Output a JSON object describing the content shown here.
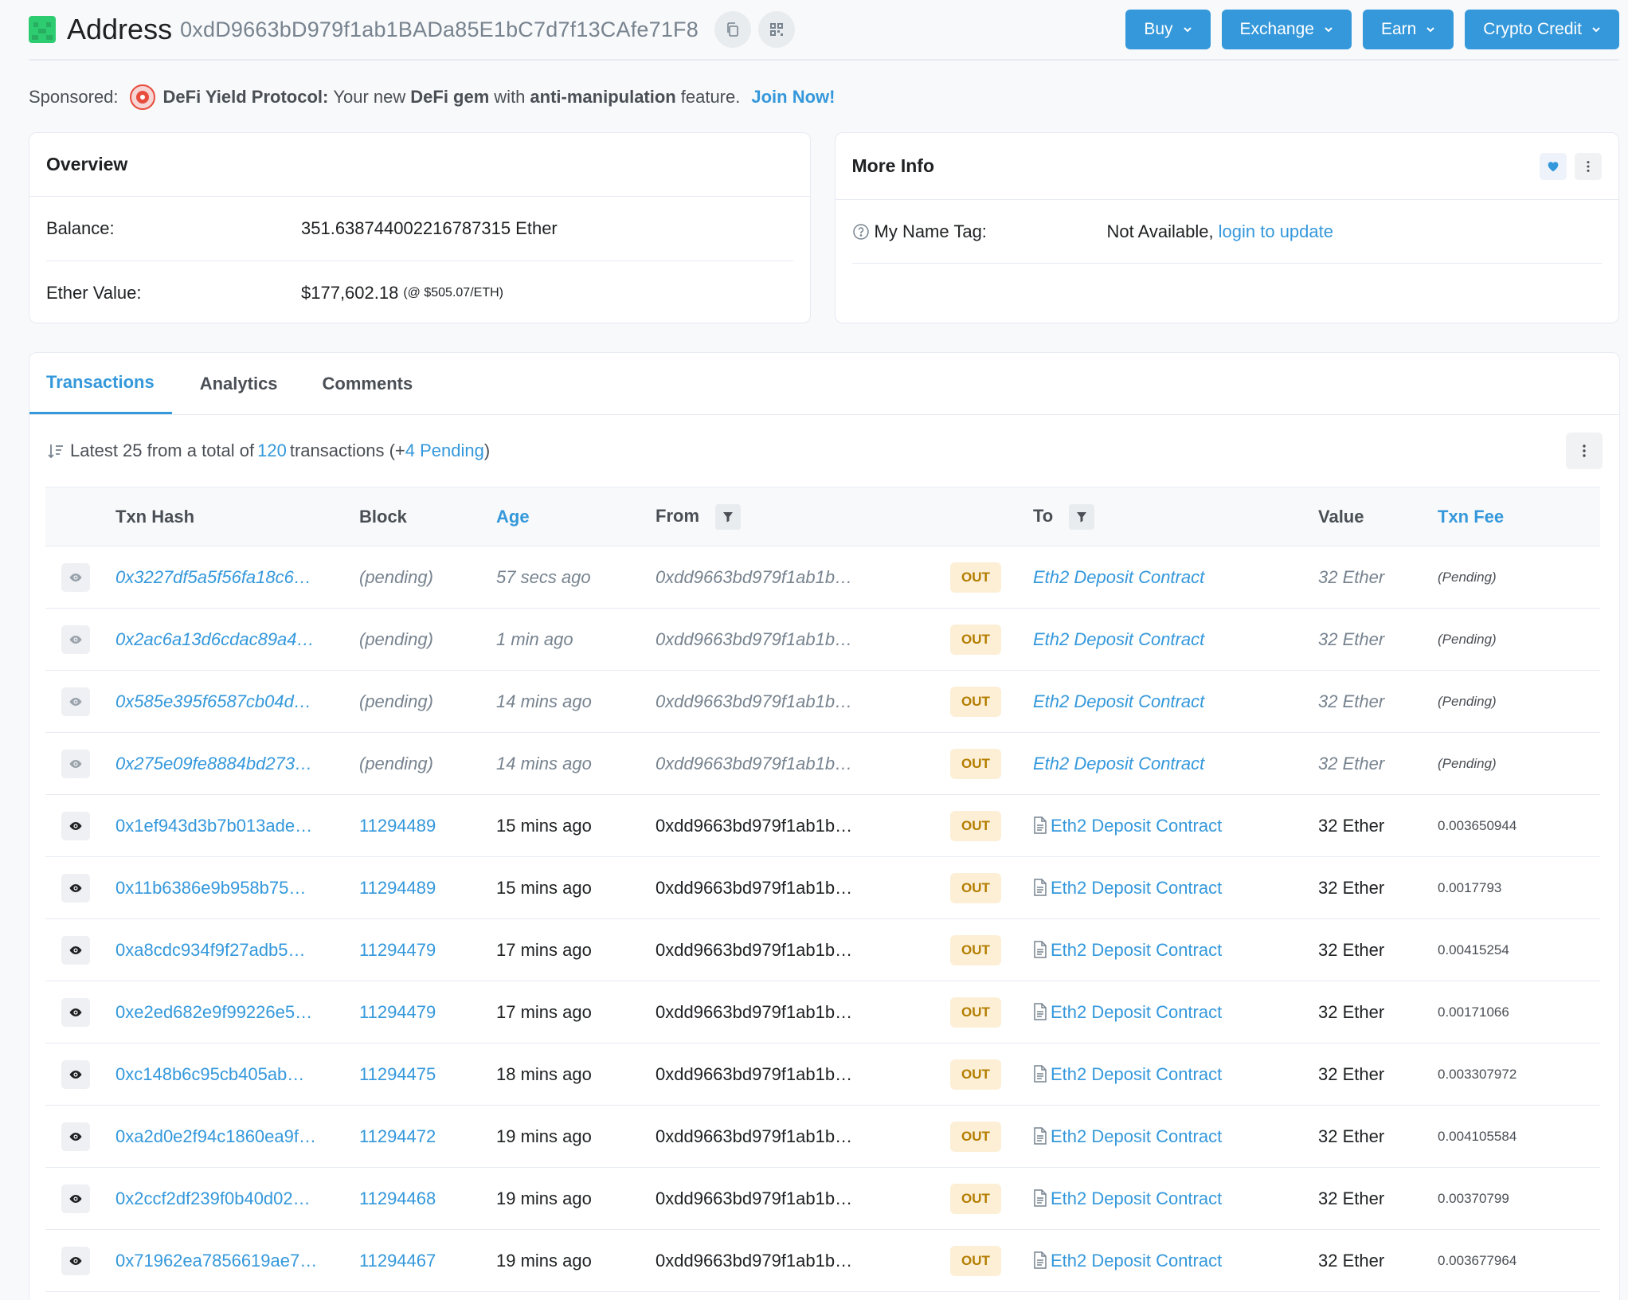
{
  "header": {
    "title": "Address",
    "address": "0xdD9663bD979f1ab1BADa85E1bC7d7f13CAfe71F8",
    "buttons": [
      {
        "label": "Buy"
      },
      {
        "label": "Exchange"
      },
      {
        "label": "Earn"
      },
      {
        "label": "Crypto Credit"
      }
    ]
  },
  "sponsor": {
    "label": "Sponsored:",
    "brand": "DeFi Yield Protocol:",
    "text1": "Your new",
    "bold1": "DeFi gem",
    "text2": "with",
    "bold2": "anti-manipulation",
    "text3": "feature.",
    "cta": "Join Now!"
  },
  "overview": {
    "title": "Overview",
    "balance_label": "Balance:",
    "balance_value": "351.638744002216787315 Ether",
    "ether_value_label": "Ether Value:",
    "ether_value": "$177,602.18",
    "ether_rate": "(@ $505.07/ETH)"
  },
  "more_info": {
    "title": "More Info",
    "name_tag_label": "My Name Tag:",
    "name_tag_value": "Not Available,",
    "login_link": "login to update"
  },
  "tabs": [
    {
      "label": "Transactions",
      "active": true
    },
    {
      "label": "Analytics",
      "active": false
    },
    {
      "label": "Comments",
      "active": false
    }
  ],
  "summary": {
    "prefix": "Latest 25 from a total of",
    "total": "120",
    "mid": "transactions (+",
    "pending": "4 Pending",
    "suffix": ")"
  },
  "table": {
    "columns": {
      "hash": "Txn Hash",
      "block": "Block",
      "age": "Age",
      "from": "From",
      "to": "To",
      "value": "Value",
      "fee": "Txn Fee"
    },
    "rows": [
      {
        "hash": "0x3227df5a5f56fa18c6…",
        "block": "(pending)",
        "age": "57 secs ago",
        "from": "0xdd9663bd979f1ab1b…",
        "dir": "OUT",
        "to": "Eth2 Deposit Contract",
        "value": "32 Ether",
        "fee": "(Pending)",
        "pending": true
      },
      {
        "hash": "0x2ac6a13d6cdac89a4…",
        "block": "(pending)",
        "age": "1 min ago",
        "from": "0xdd9663bd979f1ab1b…",
        "dir": "OUT",
        "to": "Eth2 Deposit Contract",
        "value": "32 Ether",
        "fee": "(Pending)",
        "pending": true
      },
      {
        "hash": "0x585e395f6587cb04d…",
        "block": "(pending)",
        "age": "14 mins ago",
        "from": "0xdd9663bd979f1ab1b…",
        "dir": "OUT",
        "to": "Eth2 Deposit Contract",
        "value": "32 Ether",
        "fee": "(Pending)",
        "pending": true
      },
      {
        "hash": "0x275e09fe8884bd273…",
        "block": "(pending)",
        "age": "14 mins ago",
        "from": "0xdd9663bd979f1ab1b…",
        "dir": "OUT",
        "to": "Eth2 Deposit Contract",
        "value": "32 Ether",
        "fee": "(Pending)",
        "pending": true
      },
      {
        "hash": "0x1ef943d3b7b013ade…",
        "block": "11294489",
        "age": "15 mins ago",
        "from": "0xdd9663bd979f1ab1b…",
        "dir": "OUT",
        "to": "Eth2 Deposit Contract",
        "value": "32 Ether",
        "fee": "0.003650944",
        "pending": false
      },
      {
        "hash": "0x11b6386e9b958b75…",
        "block": "11294489",
        "age": "15 mins ago",
        "from": "0xdd9663bd979f1ab1b…",
        "dir": "OUT",
        "to": "Eth2 Deposit Contract",
        "value": "32 Ether",
        "fee": "0.0017793",
        "pending": false
      },
      {
        "hash": "0xa8cdc934f9f27adb5…",
        "block": "11294479",
        "age": "17 mins ago",
        "from": "0xdd9663bd979f1ab1b…",
        "dir": "OUT",
        "to": "Eth2 Deposit Contract",
        "value": "32 Ether",
        "fee": "0.00415254",
        "pending": false
      },
      {
        "hash": "0xe2ed682e9f99226e5…",
        "block": "11294479",
        "age": "17 mins ago",
        "from": "0xdd9663bd979f1ab1b…",
        "dir": "OUT",
        "to": "Eth2 Deposit Contract",
        "value": "32 Ether",
        "fee": "0.00171066",
        "pending": false
      },
      {
        "hash": "0xc148b6c95cb405ab…",
        "block": "11294475",
        "age": "18 mins ago",
        "from": "0xdd9663bd979f1ab1b…",
        "dir": "OUT",
        "to": "Eth2 Deposit Contract",
        "value": "32 Ether",
        "fee": "0.003307972",
        "pending": false
      },
      {
        "hash": "0xa2d0e2f94c1860ea9f…",
        "block": "11294472",
        "age": "19 mins ago",
        "from": "0xdd9663bd979f1ab1b…",
        "dir": "OUT",
        "to": "Eth2 Deposit Contract",
        "value": "32 Ether",
        "fee": "0.004105584",
        "pending": false
      },
      {
        "hash": "0x2ccf2df239f0b40d02…",
        "block": "11294468",
        "age": "19 mins ago",
        "from": "0xdd9663bd979f1ab1b…",
        "dir": "OUT",
        "to": "Eth2 Deposit Contract",
        "value": "32 Ether",
        "fee": "0.00370799",
        "pending": false
      },
      {
        "hash": "0x71962ea7856619ae7…",
        "block": "11294467",
        "age": "19 mins ago",
        "from": "0xdd9663bd979f1ab1b…",
        "dir": "OUT",
        "to": "Eth2 Deposit Contract",
        "value": "32 Ether",
        "fee": "0.003677964",
        "pending": false
      }
    ]
  },
  "colors": {
    "accent": "#3498db",
    "out_badge_bg": "#fcefd6",
    "out_badge_text": "#b47d00",
    "muted": "#77838f"
  }
}
